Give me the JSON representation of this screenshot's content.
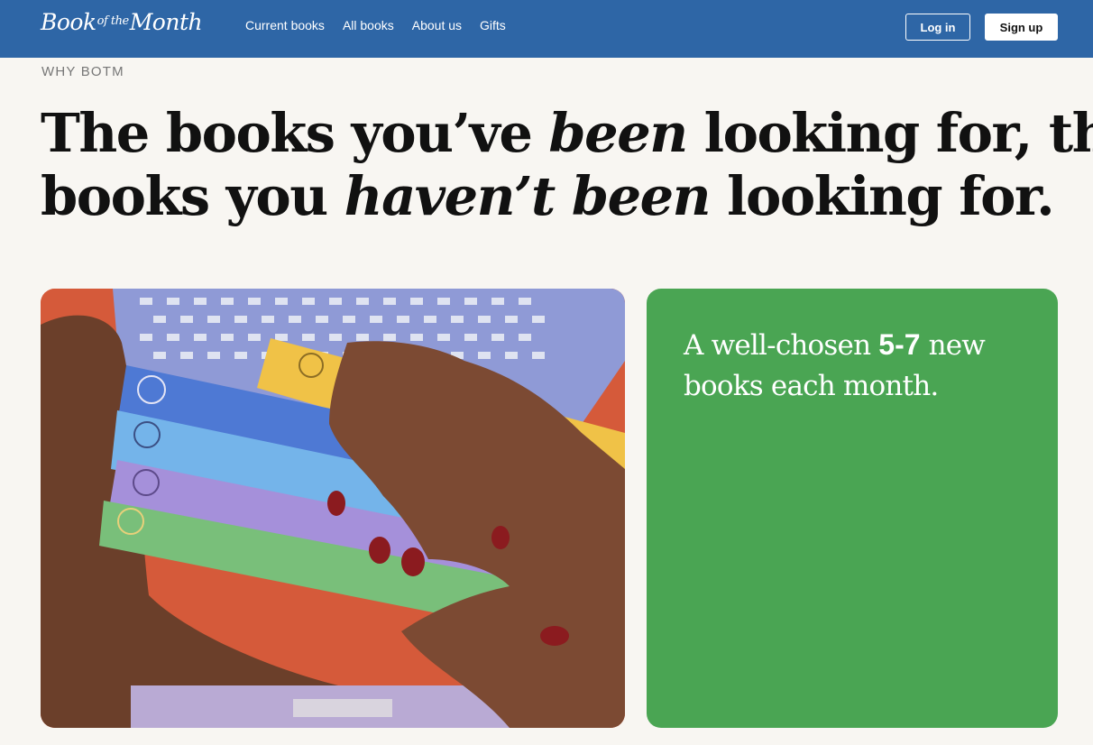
{
  "header": {
    "logo": {
      "part1": "Book",
      "part2": "of the",
      "part3": "Month"
    },
    "nav": [
      "Current books",
      "All books",
      "About us",
      "Gifts"
    ],
    "login_label": "Log in",
    "signup_label": "Sign up"
  },
  "hero": {
    "eyebrow": "WHY BOTM",
    "line1": {
      "a": "The books you’ve ",
      "b": "been",
      "c": " looking for, the"
    },
    "line2": {
      "a": "books you ",
      "b": "haven’t been",
      "c": " looking for."
    }
  },
  "feature_card": {
    "pre": "A well-chosen ",
    "highlight": "5-7",
    "post": " new books each month."
  },
  "colors": {
    "header_bg": "#2e66a6",
    "card_green": "#4aa553",
    "page_bg": "#f8f6f2"
  }
}
